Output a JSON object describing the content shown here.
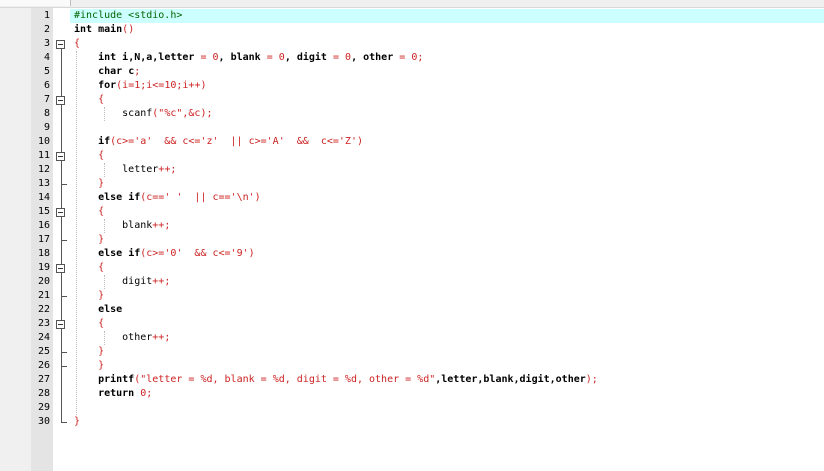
{
  "editor": {
    "lines": [
      {
        "n": "1",
        "segments": [
          {
            "t": "#include <stdio.h>",
            "c": "pp"
          }
        ]
      },
      {
        "n": "2",
        "segments": [
          {
            "t": "int",
            "c": "kw"
          },
          {
            "t": " main",
            "c": "kw"
          },
          {
            "t": "()",
            "c": "red"
          }
        ]
      },
      {
        "n": "3",
        "segments": [
          {
            "t": "{",
            "c": "red"
          }
        ]
      },
      {
        "n": "4",
        "segments": [
          {
            "t": "    int",
            "c": "kw"
          },
          {
            "t": " i,N,a,letter ",
            "c": "kw"
          },
          {
            "t": "=",
            "c": "red"
          },
          {
            "t": " ",
            "c": ""
          },
          {
            "t": "0",
            "c": "red"
          },
          {
            "t": ", blank ",
            "c": "kw"
          },
          {
            "t": "=",
            "c": "red"
          },
          {
            "t": " ",
            "c": ""
          },
          {
            "t": "0",
            "c": "red"
          },
          {
            "t": ", digit ",
            "c": "kw"
          },
          {
            "t": "=",
            "c": "red"
          },
          {
            "t": " ",
            "c": ""
          },
          {
            "t": "0",
            "c": "red"
          },
          {
            "t": ", other ",
            "c": "kw"
          },
          {
            "t": "=",
            "c": "red"
          },
          {
            "t": " ",
            "c": ""
          },
          {
            "t": "0;",
            "c": "red"
          }
        ]
      },
      {
        "n": "5",
        "segments": [
          {
            "t": "    char",
            "c": "kw"
          },
          {
            "t": " c",
            "c": "kw"
          },
          {
            "t": ";",
            "c": "red"
          }
        ]
      },
      {
        "n": "6",
        "segments": [
          {
            "t": "    for",
            "c": "kw"
          },
          {
            "t": "(i=",
            "c": "red"
          },
          {
            "t": "1",
            "c": "red"
          },
          {
            "t": ";i<=",
            "c": "red"
          },
          {
            "t": "10",
            "c": "red"
          },
          {
            "t": ";i++)",
            "c": "red"
          }
        ]
      },
      {
        "n": "7",
        "segments": [
          {
            "t": "    {",
            "c": "red"
          }
        ]
      },
      {
        "n": "8",
        "segments": [
          {
            "t": "        scanf",
            "c": ""
          },
          {
            "t": "(\"%c\",&c);",
            "c": "red"
          }
        ]
      },
      {
        "n": "9",
        "segments": []
      },
      {
        "n": "10",
        "segments": [
          {
            "t": "    if",
            "c": "kw"
          },
          {
            "t": "(c>='a'  && c<='z'  || c>='A'  &&  c<='Z')",
            "c": "red"
          }
        ]
      },
      {
        "n": "11",
        "segments": [
          {
            "t": "    {",
            "c": "red"
          }
        ]
      },
      {
        "n": "12",
        "segments": [
          {
            "t": "        letter",
            "c": ""
          },
          {
            "t": "++;",
            "c": "red"
          }
        ]
      },
      {
        "n": "13",
        "segments": [
          {
            "t": "    }",
            "c": "red"
          }
        ]
      },
      {
        "n": "14",
        "segments": [
          {
            "t": "    else",
            "c": "kw"
          },
          {
            "t": " if",
            "c": "kw"
          },
          {
            "t": "(c==' '  || c=='\\n')",
            "c": "red"
          }
        ]
      },
      {
        "n": "15",
        "segments": [
          {
            "t": "    {",
            "c": "red"
          }
        ]
      },
      {
        "n": "16",
        "segments": [
          {
            "t": "        blank",
            "c": ""
          },
          {
            "t": "++;",
            "c": "red"
          }
        ]
      },
      {
        "n": "17",
        "segments": [
          {
            "t": "    }",
            "c": "red"
          }
        ]
      },
      {
        "n": "18",
        "segments": [
          {
            "t": "    else",
            "c": "kw"
          },
          {
            "t": " if",
            "c": "kw"
          },
          {
            "t": "(c>='0'  && c<='9')",
            "c": "red"
          }
        ]
      },
      {
        "n": "19",
        "segments": [
          {
            "t": "    {",
            "c": "red"
          }
        ]
      },
      {
        "n": "20",
        "segments": [
          {
            "t": "        digit",
            "c": ""
          },
          {
            "t": "++;",
            "c": "red"
          }
        ]
      },
      {
        "n": "21",
        "segments": [
          {
            "t": "    }",
            "c": "red"
          }
        ]
      },
      {
        "n": "22",
        "segments": [
          {
            "t": "    else",
            "c": "kw"
          }
        ]
      },
      {
        "n": "23",
        "segments": [
          {
            "t": "    {",
            "c": "red"
          }
        ]
      },
      {
        "n": "24",
        "segments": [
          {
            "t": "        other",
            "c": ""
          },
          {
            "t": "++;",
            "c": "red"
          }
        ]
      },
      {
        "n": "25",
        "segments": [
          {
            "t": "    }",
            "c": "red"
          }
        ]
      },
      {
        "n": "26",
        "segments": [
          {
            "t": "    }",
            "c": "red"
          }
        ]
      },
      {
        "n": "27",
        "segments": [
          {
            "t": "    printf",
            "c": "kw"
          },
          {
            "t": "(\"letter = %d, blank = %d, digit = %d, other = %d\"",
            "c": "red"
          },
          {
            "t": ",letter,blank,digit,other",
            "c": "kw"
          },
          {
            "t": ");",
            "c": "red"
          }
        ]
      },
      {
        "n": "28",
        "segments": [
          {
            "t": "    return",
            "c": "kw"
          },
          {
            "t": " ",
            "c": ""
          },
          {
            "t": "0;",
            "c": "red"
          }
        ]
      },
      {
        "n": "29",
        "segments": []
      },
      {
        "n": "30",
        "segments": [
          {
            "t": "}",
            "c": "red"
          }
        ]
      }
    ]
  }
}
